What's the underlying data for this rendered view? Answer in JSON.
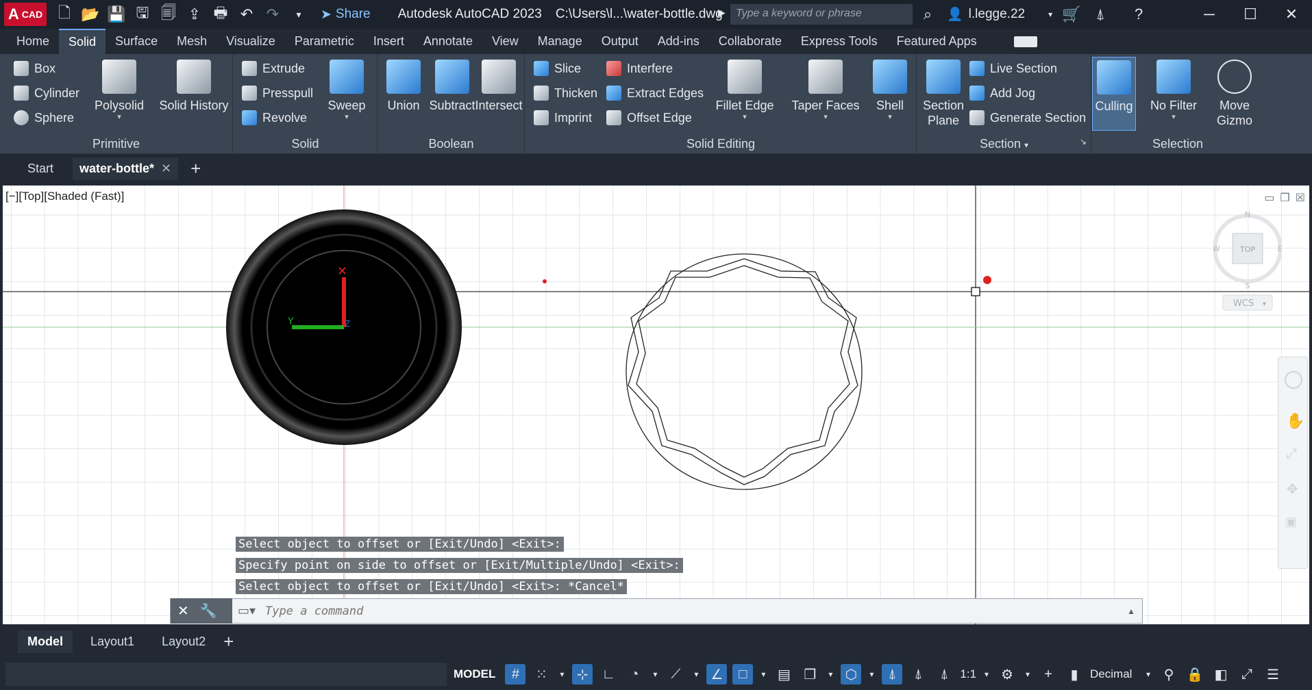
{
  "app": {
    "logo_letter": "A",
    "logo_text": "CAD",
    "title": "Autodesk AutoCAD 2023",
    "path": "C:\\Users\\l...\\water-bottle.dwg",
    "share_label": "Share",
    "search_placeholder": "Type a keyword or phrase",
    "user": "l.legge.22"
  },
  "ribbon_tabs": [
    "Home",
    "Solid",
    "Surface",
    "Mesh",
    "Visualize",
    "Parametric",
    "Insert",
    "Annotate",
    "View",
    "Manage",
    "Output",
    "Add-ins",
    "Collaborate",
    "Express Tools",
    "Featured Apps"
  ],
  "ribbon": {
    "primitive": {
      "title": "Primitive",
      "box": "Box",
      "cylinder": "Cylinder",
      "sphere": "Sphere",
      "polysolid": "Polysolid",
      "solid_history": "Solid History"
    },
    "solid": {
      "title": "Solid",
      "extrude": "Extrude",
      "presspull": "Presspull",
      "revolve": "Revolve",
      "sweep": "Sweep"
    },
    "boolean": {
      "title": "Boolean",
      "union": "Union",
      "subtract": "Subtract",
      "intersect": "Intersect"
    },
    "solid_editing": {
      "title": "Solid Editing",
      "slice": "Slice",
      "thicken": "Thicken",
      "imprint": "Imprint",
      "interfere": "Interfere",
      "extract_edges": "Extract Edges",
      "offset_edge": "Offset Edge",
      "fillet_edge": "Fillet Edge",
      "taper_faces": "Taper Faces",
      "shell": "Shell"
    },
    "section": {
      "title": "Section",
      "section_plane_1": "Section",
      "section_plane_2": "Plane",
      "live_section": "Live Section",
      "add_jog": "Add Jog",
      "generate_section": "Generate Section"
    },
    "selection": {
      "title": "Selection",
      "culling": "Culling",
      "no_filter": "No Filter",
      "move_gizmo_1": "Move",
      "move_gizmo_2": "Gizmo"
    }
  },
  "doc_tabs": {
    "start": "Start",
    "active": "water-bottle*"
  },
  "viewport": {
    "label": "[−][Top][Shaded (Fast)]",
    "viewcube_face": "TOP",
    "wcs": "WCS",
    "compass": {
      "n": "N",
      "s": "S",
      "e": "E",
      "w": "W"
    }
  },
  "command": {
    "history": [
      "Select object to offset or [Exit/Undo] <Exit>:",
      "Specify point on side to offset or [Exit/Multiple/Undo] <Exit>:",
      "Select object to offset or [Exit/Undo] <Exit>: *Cancel*"
    ],
    "placeholder": "Type a command"
  },
  "layout_tabs": [
    "Model",
    "Layout1",
    "Layout2"
  ],
  "status": {
    "model": "MODEL",
    "scale": "1:1",
    "units": "Decimal"
  },
  "colors": {
    "accent": "#2f6fb4",
    "ribbon_bg": "#3a4553",
    "title_bg": "#1b222c",
    "logo_red": "#c8102e"
  }
}
